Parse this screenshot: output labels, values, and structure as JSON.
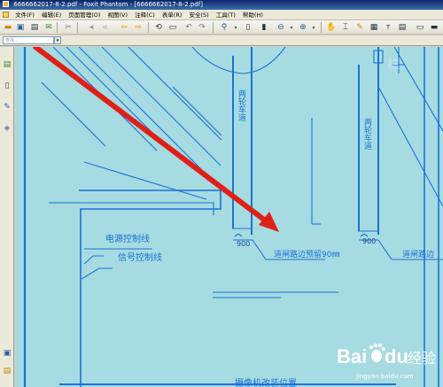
{
  "window": {
    "title": "6666662017-8-2.pdf - Foxit Phantom - [6666662017-8-2.pdf]"
  },
  "menu": [
    "文件(F)",
    "编辑(E)",
    "页面管理(O)",
    "视图(V)",
    "注释(C)",
    "表单(R)",
    "安全(S)",
    "工具(T)",
    "帮助(H)"
  ],
  "nav": {
    "search_placeholder": "查找..."
  },
  "drawing": {
    "label_power": "电源控制线",
    "label_signal": "信号控制线",
    "label_left_lane": "两轮车道",
    "label_right_lane": "两轮车道",
    "dim_left": "900",
    "dim_right": "900",
    "note_gate": "道闸路边预留90㎜",
    "note_gate_right": "道闸路边",
    "note_camera": "摄像机改装位置",
    "top_text": "栏"
  },
  "watermark": {
    "brand": "Bai",
    "paw": "du",
    "suffix": "经验",
    "domain": "jingyan.baidu.com"
  },
  "colors": {
    "canvas_bg": "#a6dbe1",
    "line": "#1a73d8",
    "arrow": "#e02018"
  }
}
